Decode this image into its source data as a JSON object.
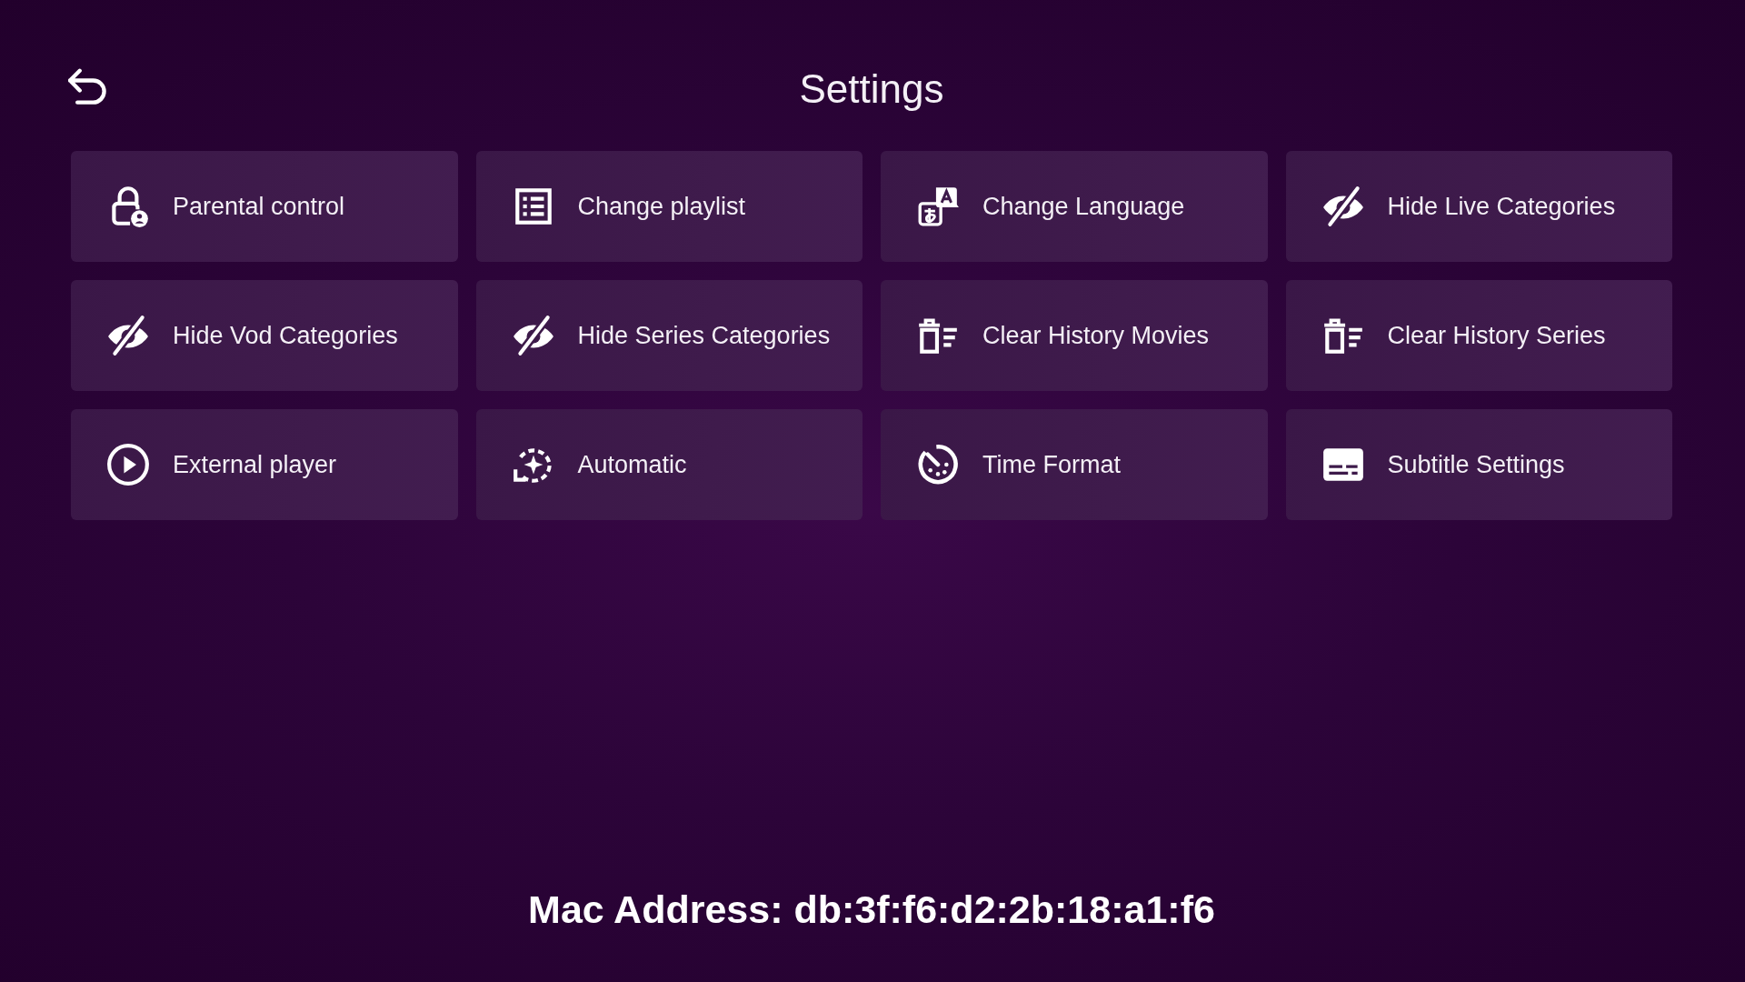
{
  "header": {
    "title": "Settings"
  },
  "tiles": [
    {
      "label": "Parental control",
      "kind": "lock"
    },
    {
      "label": "Change playlist",
      "kind": "playlist"
    },
    {
      "label": "Change Language",
      "kind": "language"
    },
    {
      "label": "Hide Live Categories",
      "kind": "hide"
    },
    {
      "label": "Hide Vod Categories",
      "kind": "hide"
    },
    {
      "label": "Hide Series Categories",
      "kind": "hide"
    },
    {
      "label": "Clear History Movies",
      "kind": "clear"
    },
    {
      "label": "Clear History Series",
      "kind": "clear"
    },
    {
      "label": "External player",
      "kind": "player"
    },
    {
      "label": "Automatic",
      "kind": "automatic"
    },
    {
      "label": "Time Format",
      "kind": "clock"
    },
    {
      "label": "Subtitle Settings",
      "kind": "subtitles"
    }
  ],
  "footer": {
    "mac_address": "Mac Address: db:3f:f6:d2:2b:18:a1:f6"
  }
}
